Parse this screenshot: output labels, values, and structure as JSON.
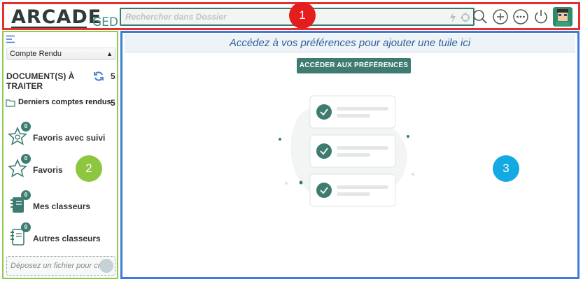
{
  "header": {
    "logo_main": "ARCADE",
    "logo_sub": "GED",
    "search_placeholder": "Rechercher dans Dossier",
    "icons": [
      "bolt-icon",
      "crosshair-icon",
      "search-icon",
      "add-icon",
      "more-icon",
      "power-icon",
      "user-avatar"
    ]
  },
  "markers": {
    "one": "1",
    "two": "2",
    "three": "3"
  },
  "sidebar": {
    "select_value": "Compte Rendu",
    "documents_heading": "DOCUMENT(S) À TRAITER",
    "documents_count": "5",
    "last_reports_label": "Derniers comptes rendus",
    "last_reports_count": "5",
    "nav": [
      {
        "label": "Favoris avec suivi",
        "badge": "0",
        "icon": "star-tracking-icon"
      },
      {
        "label": "Favoris",
        "badge": "0",
        "icon": "star-icon"
      },
      {
        "label": "Mes classeurs",
        "badge": "0",
        "icon": "binder-icon"
      },
      {
        "label": "Autres classeurs",
        "badge": "0",
        "icon": "binder-outline-icon"
      }
    ],
    "drop_text": "Déposez un fichier pour cr..."
  },
  "main": {
    "banner_text": "Accédez à vos préférences pour ajouter une tuile ici",
    "prefs_button": "ACCÉDER AUX PRÉFÉRENCES"
  },
  "colors": {
    "accent": "#3e7b71",
    "region1": "#e53030",
    "region2": "#8ccb4c",
    "region3": "#3f7bd8",
    "banner_text": "#2e5f9a"
  }
}
